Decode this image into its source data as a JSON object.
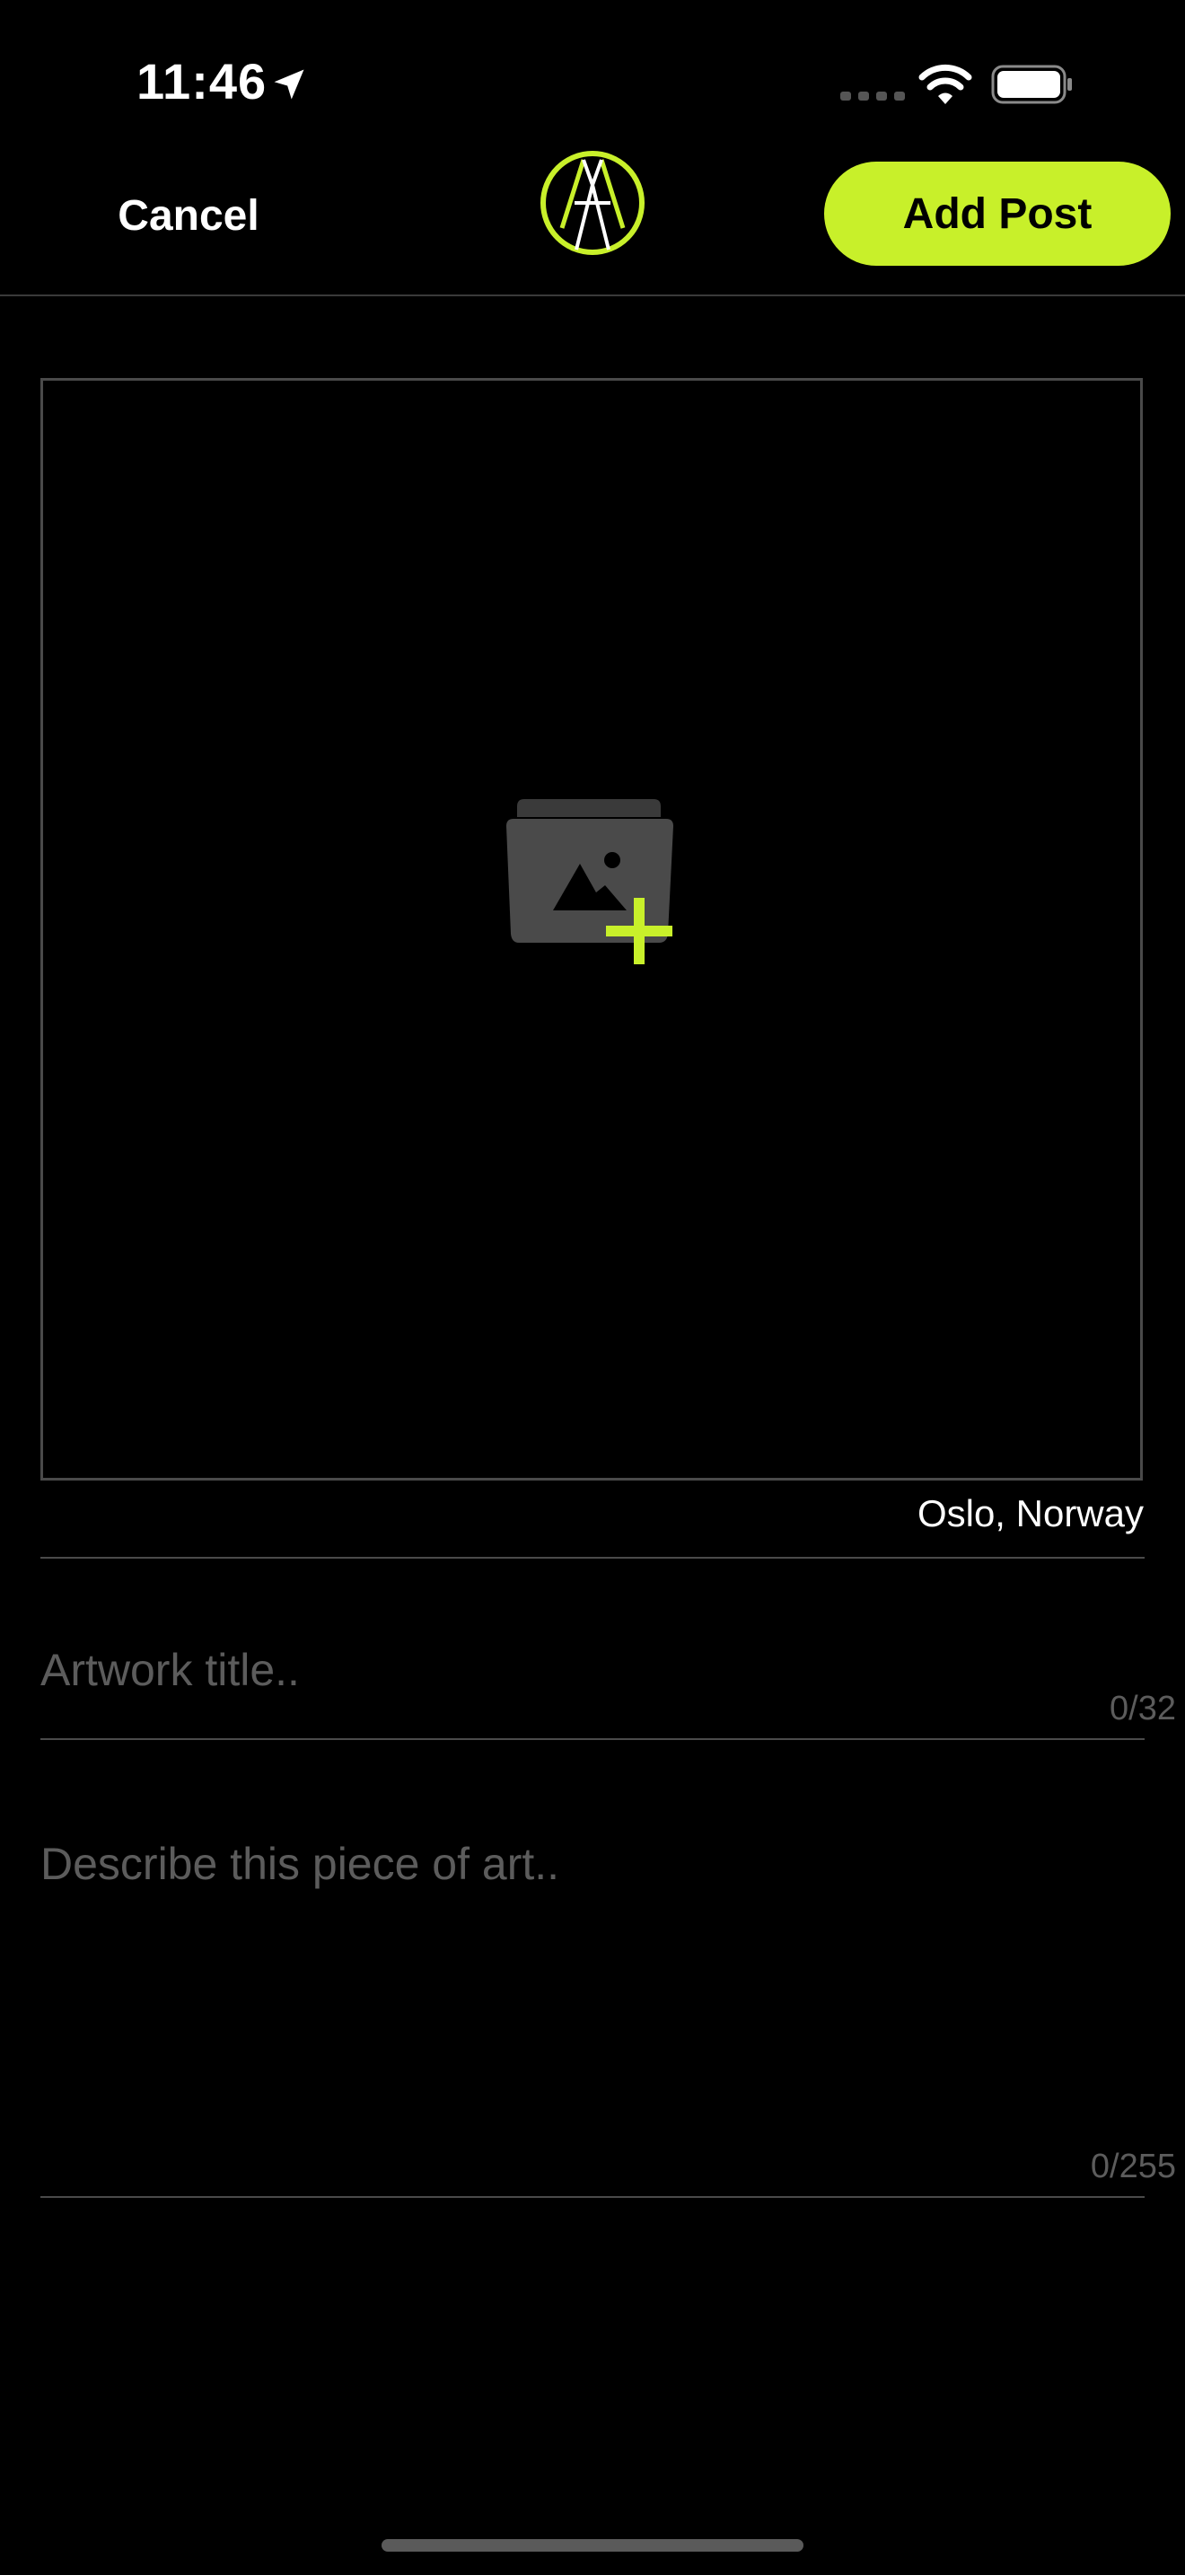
{
  "status_bar": {
    "time": "11:46"
  },
  "nav": {
    "cancel_label": "Cancel",
    "add_post_label": "Add Post"
  },
  "image_picker": {
    "location": "Oslo, Norway"
  },
  "title_field": {
    "placeholder": "Artwork title..",
    "value": "",
    "counter": "0/32"
  },
  "description_field": {
    "placeholder": "Describe this piece of art..",
    "value": "",
    "counter": "0/255"
  },
  "colors": {
    "accent": "#c8f02a",
    "background": "#000000",
    "divider": "#4a4a4a",
    "placeholder": "#5c5c5c",
    "icon_gray": "#4a4a4a"
  },
  "icons": [
    "location-arrow-icon",
    "cellular-signal-icon",
    "wifi-icon",
    "battery-icon",
    "app-logo",
    "add-photo-icon"
  ]
}
